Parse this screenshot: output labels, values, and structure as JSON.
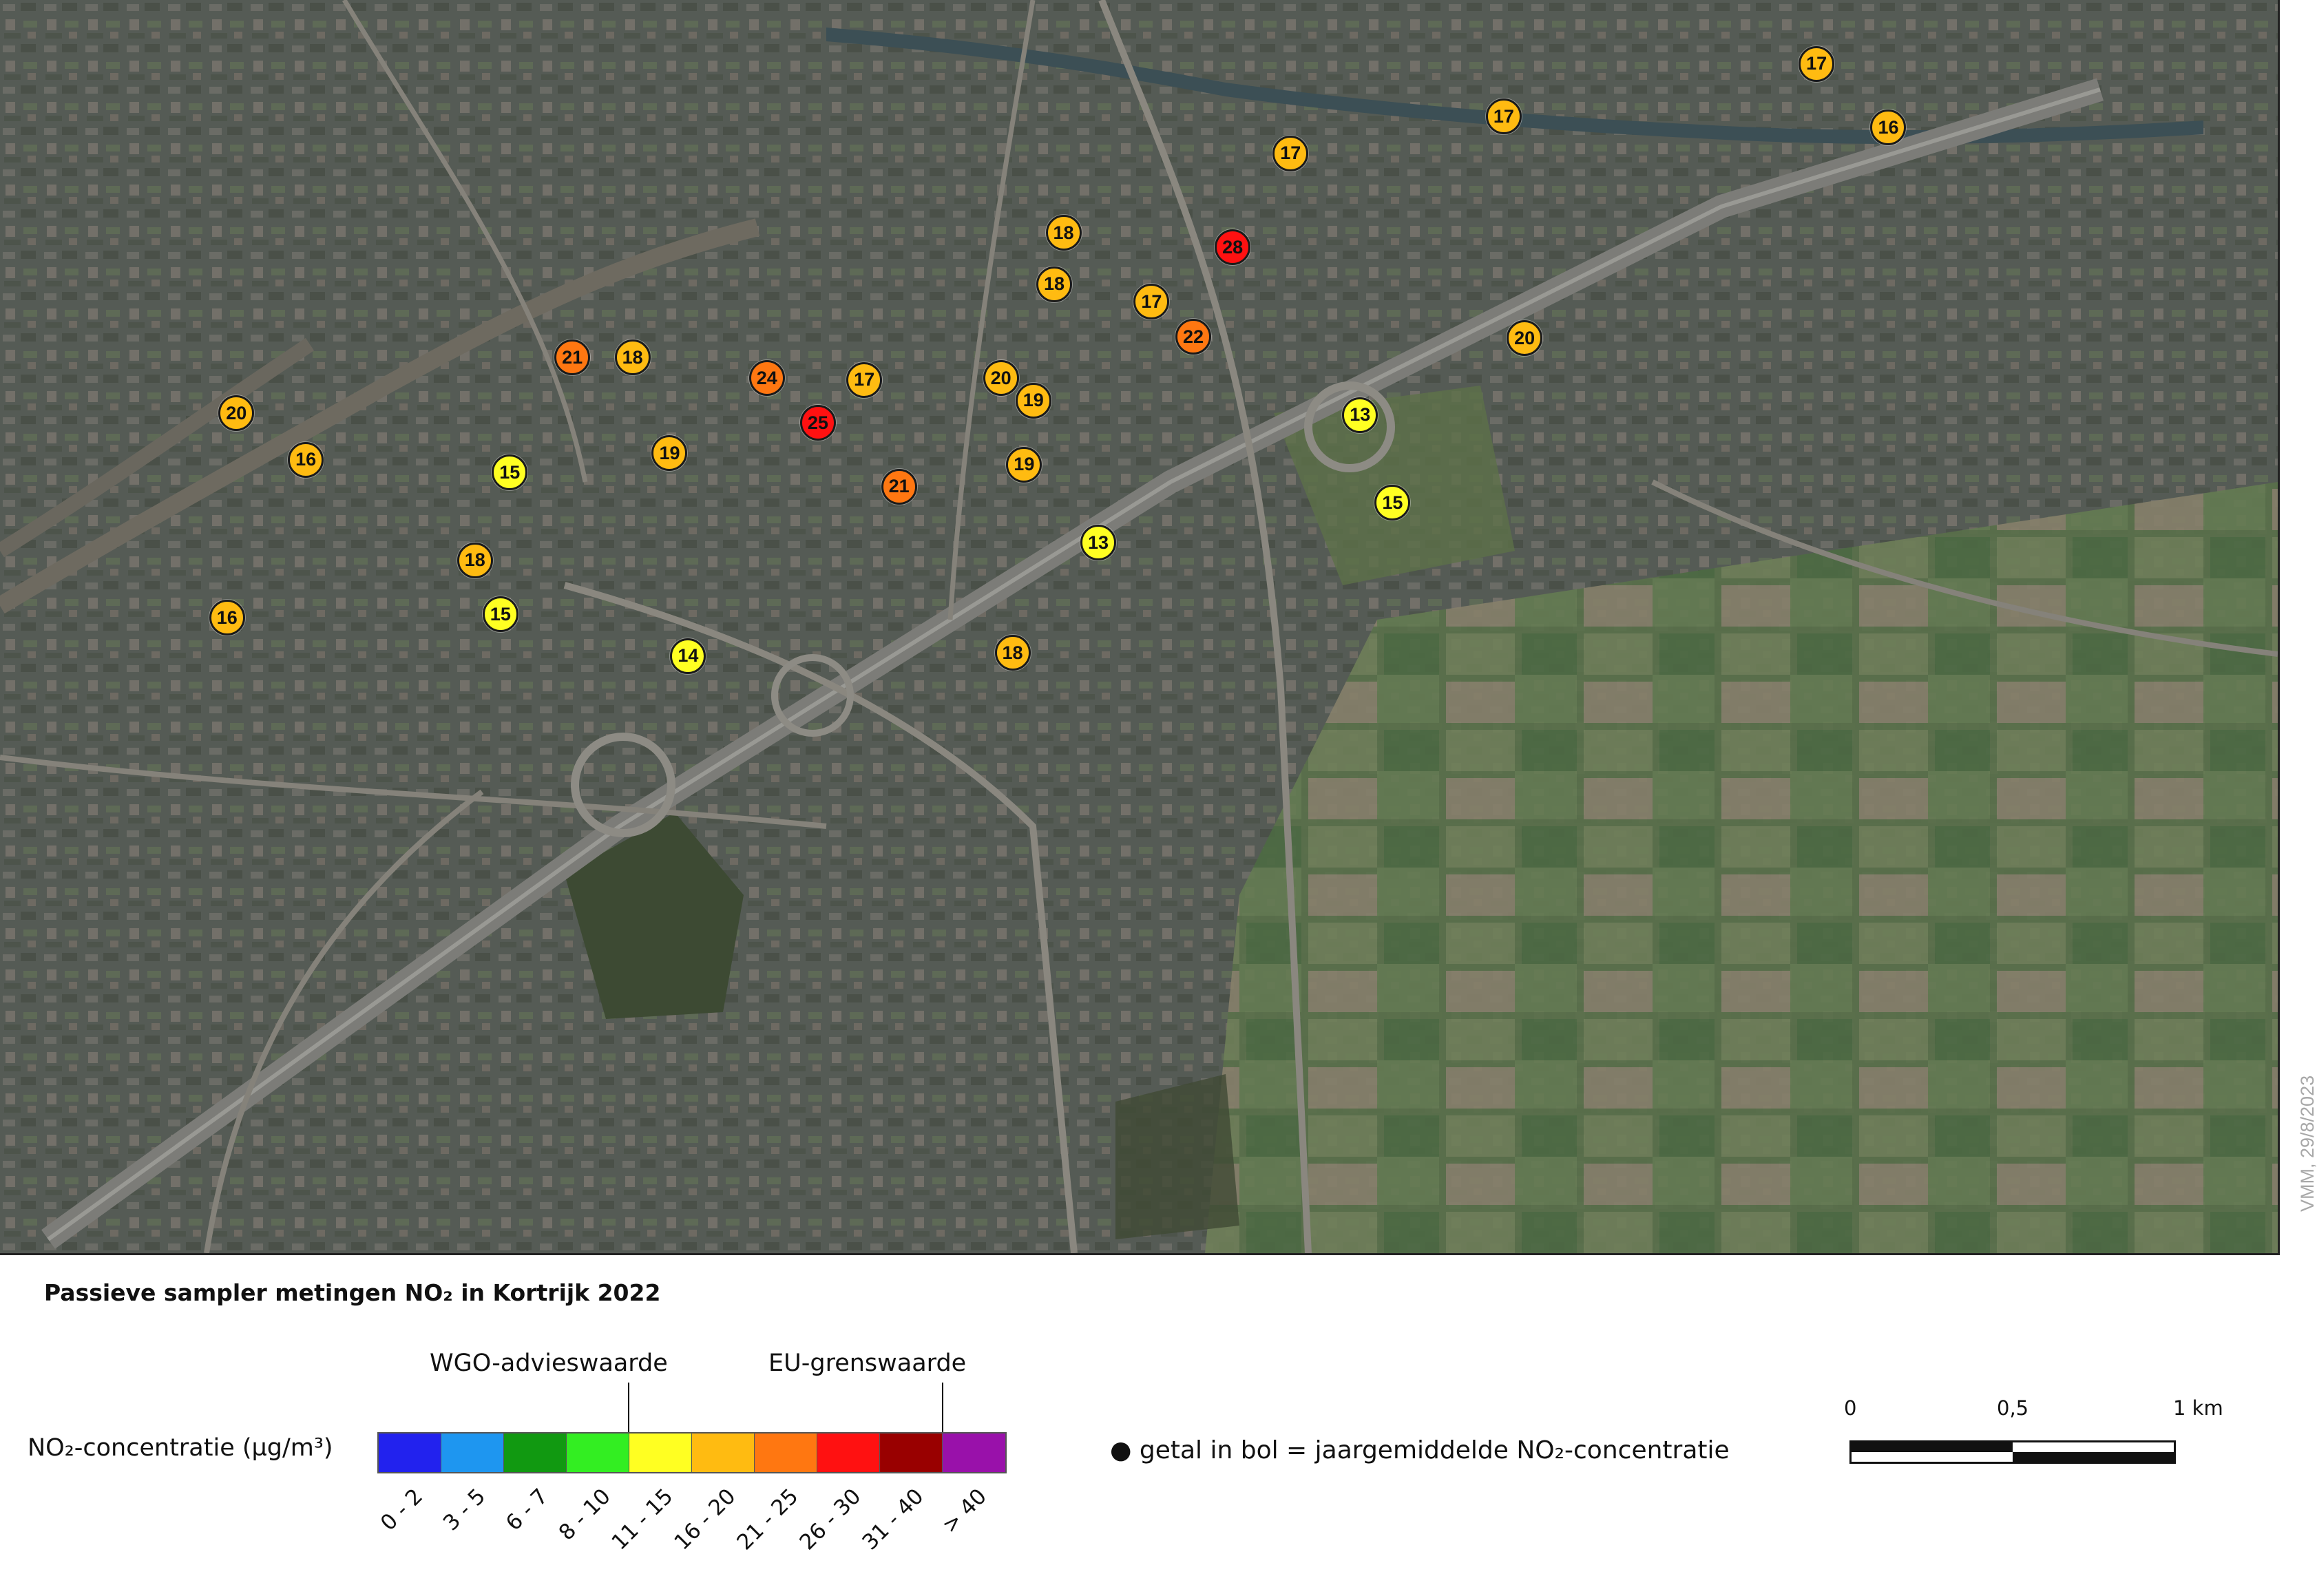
{
  "map": {
    "markers": [
      {
        "label": "17",
        "x": 0.784,
        "y": 0.04,
        "level": 5
      },
      {
        "label": "17",
        "x": 0.649,
        "y": 0.073,
        "level": 5
      },
      {
        "label": "16",
        "x": 0.815,
        "y": 0.08,
        "level": 5
      },
      {
        "label": "17",
        "x": 0.557,
        "y": 0.096,
        "level": 5
      },
      {
        "label": "18",
        "x": 0.459,
        "y": 0.146,
        "level": 5
      },
      {
        "label": "28",
        "x": 0.532,
        "y": 0.155,
        "level": 7
      },
      {
        "label": "18",
        "x": 0.455,
        "y": 0.178,
        "level": 5
      },
      {
        "label": "17",
        "x": 0.497,
        "y": 0.189,
        "level": 5
      },
      {
        "label": "22",
        "x": 0.515,
        "y": 0.211,
        "level": 6
      },
      {
        "label": "20",
        "x": 0.658,
        "y": 0.212,
        "level": 5
      },
      {
        "label": "21",
        "x": 0.247,
        "y": 0.224,
        "level": 6
      },
      {
        "label": "18",
        "x": 0.273,
        "y": 0.224,
        "level": 5
      },
      {
        "label": "24",
        "x": 0.331,
        "y": 0.237,
        "level": 6
      },
      {
        "label": "17",
        "x": 0.373,
        "y": 0.238,
        "level": 5
      },
      {
        "label": "20",
        "x": 0.432,
        "y": 0.237,
        "level": 5
      },
      {
        "label": "19",
        "x": 0.446,
        "y": 0.251,
        "level": 5
      },
      {
        "label": "20",
        "x": 0.102,
        "y": 0.259,
        "level": 5
      },
      {
        "label": "13",
        "x": 0.587,
        "y": 0.26,
        "level": 4
      },
      {
        "label": "25",
        "x": 0.353,
        "y": 0.265,
        "level": 7
      },
      {
        "label": "19",
        "x": 0.289,
        "y": 0.284,
        "level": 5
      },
      {
        "label": "16",
        "x": 0.132,
        "y": 0.288,
        "level": 5
      },
      {
        "label": "19",
        "x": 0.442,
        "y": 0.291,
        "level": 5
      },
      {
        "label": "15",
        "x": 0.22,
        "y": 0.296,
        "level": 4
      },
      {
        "label": "21",
        "x": 0.388,
        "y": 0.305,
        "level": 6
      },
      {
        "label": "15",
        "x": 0.601,
        "y": 0.315,
        "level": 4
      },
      {
        "label": "13",
        "x": 0.474,
        "y": 0.34,
        "level": 4
      },
      {
        "label": "18",
        "x": 0.205,
        "y": 0.351,
        "level": 5
      },
      {
        "label": "15",
        "x": 0.216,
        "y": 0.385,
        "level": 4
      },
      {
        "label": "16",
        "x": 0.098,
        "y": 0.387,
        "level": 5
      },
      {
        "label": "14",
        "x": 0.297,
        "y": 0.411,
        "level": 4
      },
      {
        "label": "18",
        "x": 0.437,
        "y": 0.409,
        "level": 5
      }
    ]
  },
  "credit": "VMM, 29/8/2023",
  "legend": {
    "title": "Passieve sampler metingen NO₂ in Kortrijk 2022",
    "concentration_label": "NO₂-concentratie (µg/m³)",
    "who_label": "WGO-advieswaarde",
    "eu_label": "EU-grenswaarde",
    "classes": [
      {
        "range": "0 - 2",
        "color": "#2222ee"
      },
      {
        "range": "3 - 5",
        "color": "#1e96f0"
      },
      {
        "range": "6 - 7",
        "color": "#119911"
      },
      {
        "range": "8 - 10",
        "color": "#33ee22"
      },
      {
        "range": "11 - 15",
        "color": "#ffff22"
      },
      {
        "range": "16 - 20",
        "color": "#ffbb11"
      },
      {
        "range": "21 - 25",
        "color": "#ff7711"
      },
      {
        "range": "26 - 30",
        "color": "#ff1111"
      },
      {
        "range": "31 - 40",
        "color": "#990000"
      },
      {
        "range": "> 40",
        "color": "#9911aa"
      }
    ],
    "note": "● getal in bol = jaargemiddelde NO₂-concentratie"
  },
  "scale": {
    "labels": [
      "0",
      "0,5",
      "1 km"
    ]
  }
}
